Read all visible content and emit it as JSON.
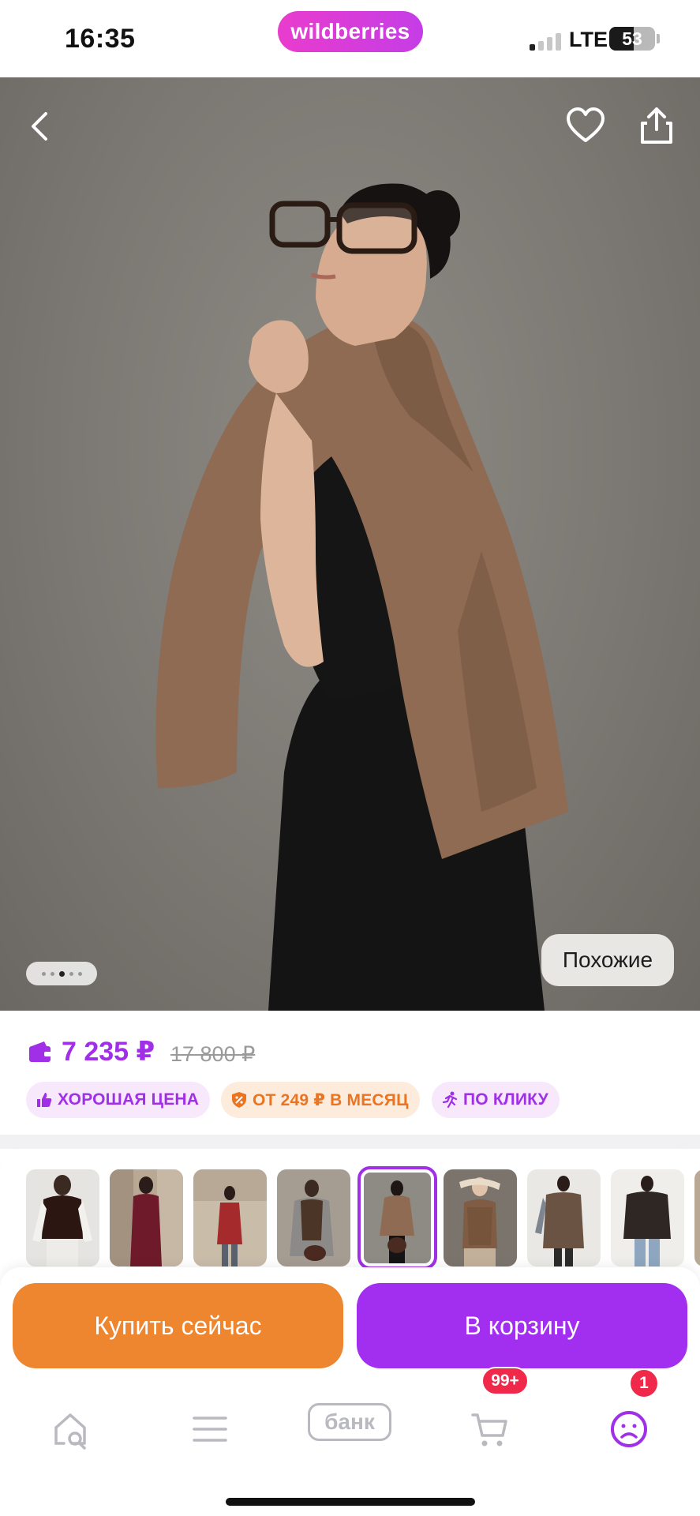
{
  "status_bar": {
    "time": "16:35",
    "brand": "wildberries",
    "network": "LTE",
    "battery": "53",
    "battery_level": 0.53
  },
  "hero": {
    "icons": [
      "back-arrow-icon",
      "heart-icon",
      "share-icon"
    ],
    "similar_label": "Похожие",
    "carousel_dots": 5,
    "carousel_active": 2
  },
  "price": {
    "current": "7 235 ₽",
    "old": "17 800 ₽"
  },
  "badges": [
    {
      "label": "ХОРОШАЯ ЦЕНА",
      "icon": "thumbs-up-icon"
    },
    {
      "label": "ОТ 249 ₽ В МЕСЯЦ",
      "icon": "percent-shield-icon"
    },
    {
      "label": "ПО КЛИКУ",
      "icon": "runner-icon"
    }
  ],
  "thumbnails": {
    "count": 9,
    "selected_index": 4
  },
  "actions": {
    "buy_now": "Купить сейчас",
    "to_cart": "В корзину"
  },
  "bottom_nav": {
    "items": [
      "home-search-icon",
      "menu-icon",
      "bank-logo",
      "cart-icon",
      "profile-icon"
    ],
    "bank_label": "банк",
    "cart_badge": "99+",
    "profile_badge": "1"
  },
  "colors": {
    "accent_purple": "#a12fe8",
    "buy_orange": "#ee852f",
    "cart_purple": "#a22ff0",
    "badge_red": "#f0294b"
  }
}
